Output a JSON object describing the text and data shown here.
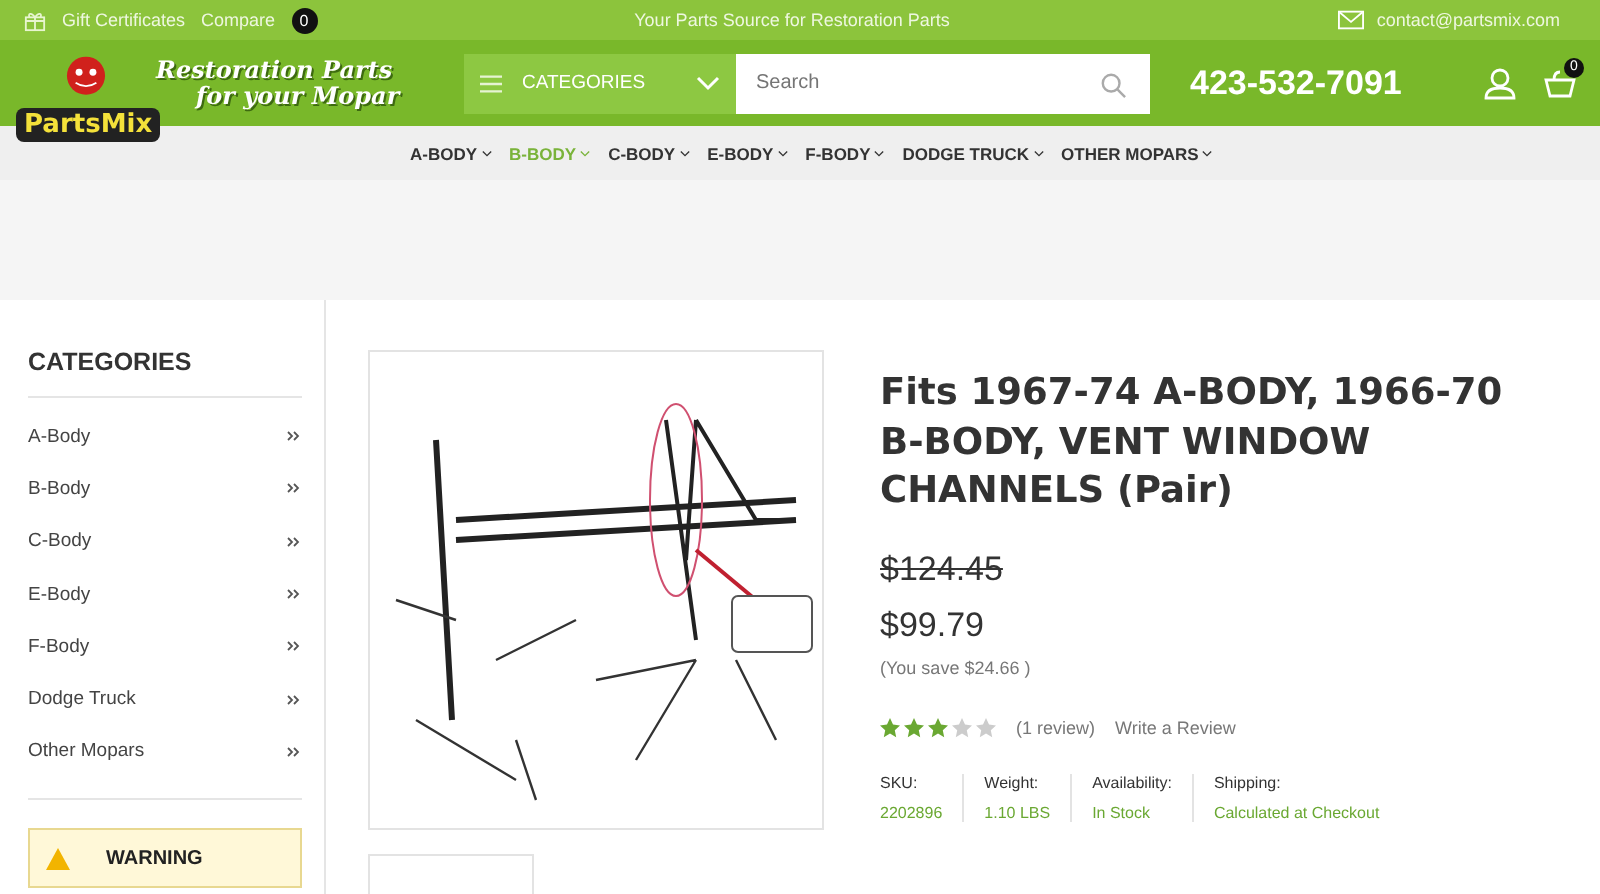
{
  "top_bar": {
    "gift_certificates": "Gift Certificates",
    "compare": "Compare",
    "compare_count": "0",
    "tagline": "Your Parts Source for Restoration Parts",
    "email": "contact@partsmix.com"
  },
  "header": {
    "logo_text": "PartsMix",
    "slogan": [
      "Restoration Parts",
      "for your Mopar"
    ],
    "categories_label": "CATEGORIES",
    "search": {
      "placeholder": "Search"
    },
    "phone": "423-532-7091",
    "cart_count": "0"
  },
  "nav": [
    {
      "label": "A-BODY",
      "selected": false
    },
    {
      "label": "B-BODY",
      "selected": true
    },
    {
      "label": "C-BODY",
      "selected": false
    },
    {
      "label": "E-BODY",
      "selected": false
    },
    {
      "label": "F-BODY",
      "selected": false
    },
    {
      "label": "DODGE TRUCK",
      "selected": false
    },
    {
      "label": "OTHER MOPARS",
      "selected": false
    }
  ],
  "sidebar": {
    "title": "CATEGORIES",
    "items": [
      "A-Body",
      "B-Body",
      "C-Body",
      "E-Body",
      "F-Body",
      "Dodge Truck",
      "Other Mopars"
    ],
    "warning": "WARNING"
  },
  "product": {
    "title": "Fits 1967-74 A-BODY, 1966-70 B-BODY, VENT WINDOW CHANNELS (Pair)",
    "old_price": "$124.45",
    "price": "$99.79",
    "savings": "(You save $24.66 )",
    "stars": 3,
    "reviews": "(1 review)",
    "write_review": "Write a Review",
    "specs": [
      {
        "label": "SKU:",
        "value": "2202896"
      },
      {
        "label": "Weight:",
        "value": "1.10 LBS"
      },
      {
        "label": "Availability:",
        "value": "In Stock"
      },
      {
        "label": "Shipping:",
        "value": "Calculated at Checkout"
      }
    ]
  }
}
